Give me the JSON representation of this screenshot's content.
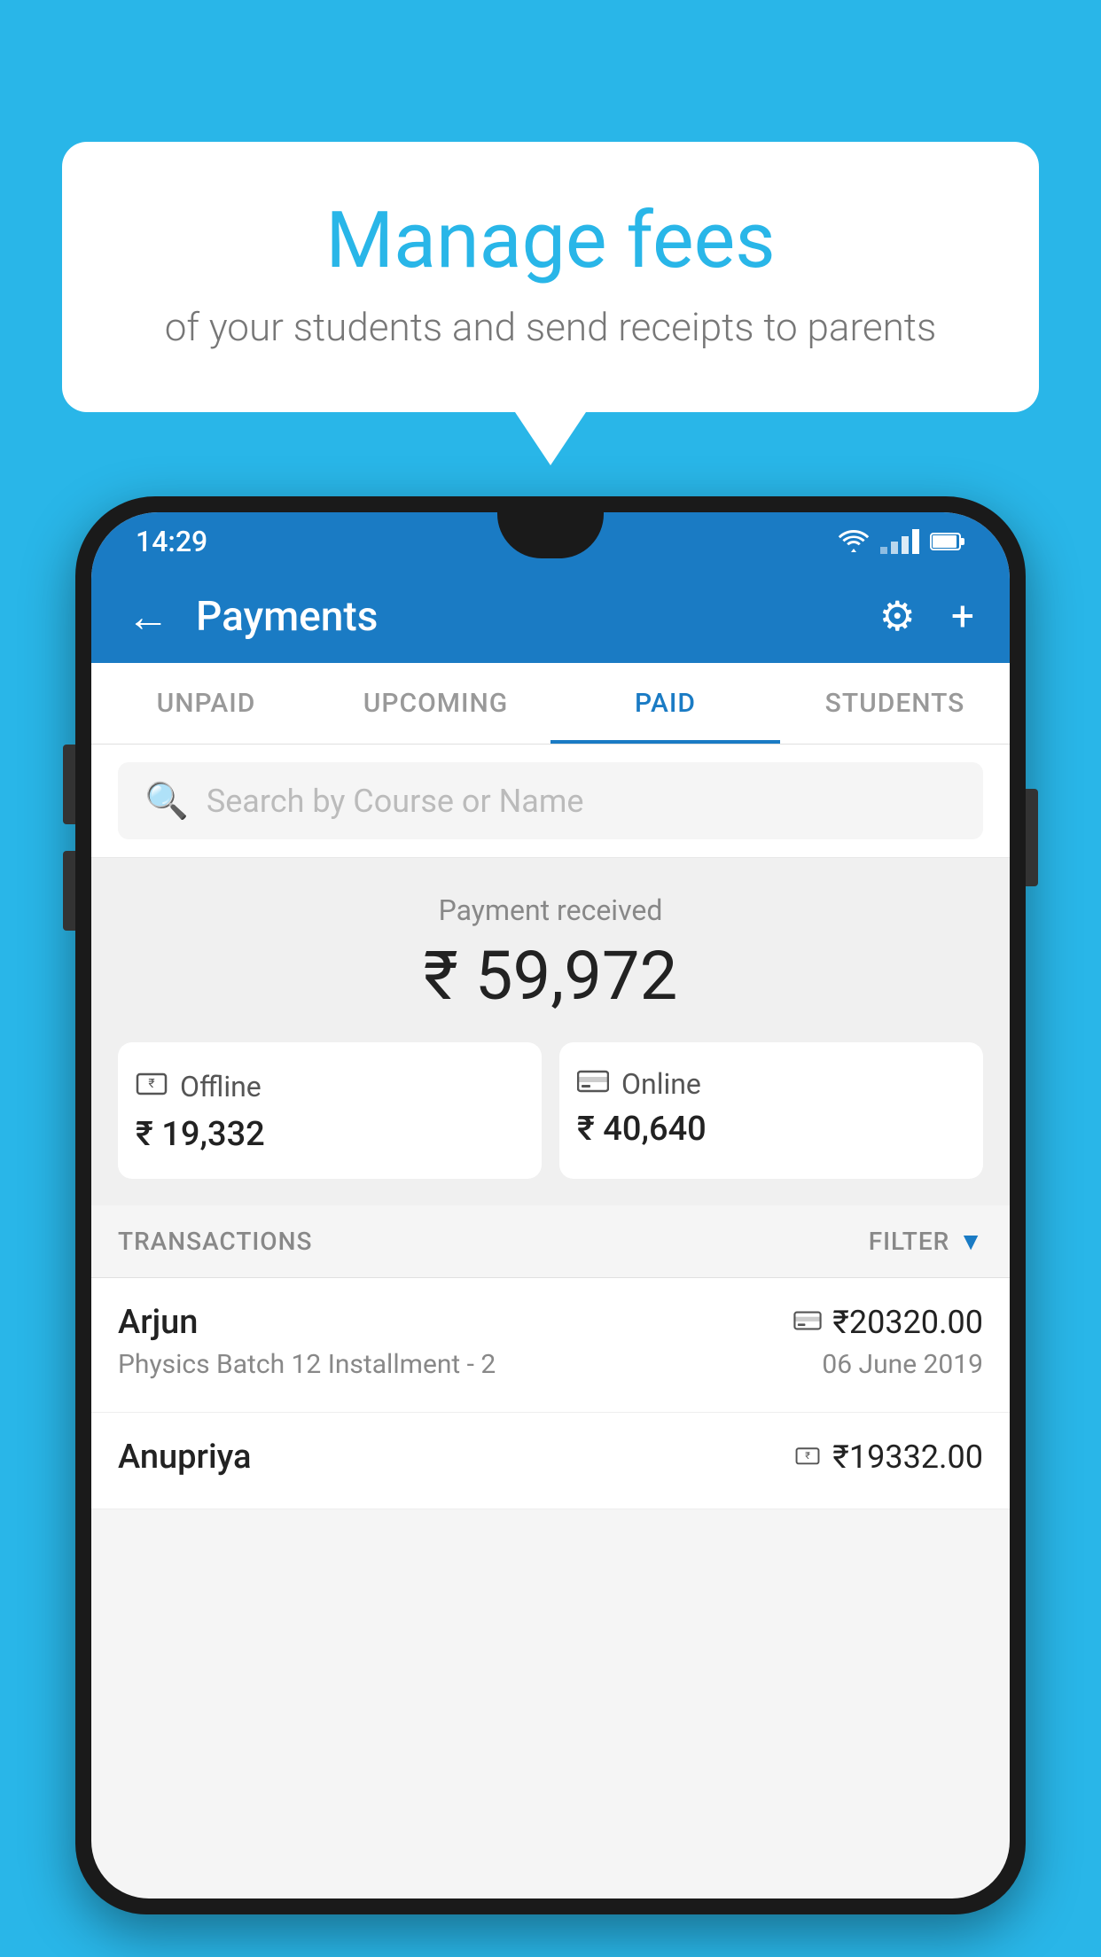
{
  "background_color": "#29b6e8",
  "speech_bubble": {
    "title": "Manage fees",
    "subtitle": "of your students and send receipts to parents"
  },
  "status_bar": {
    "time": "14:29"
  },
  "header": {
    "title": "Payments",
    "back_label": "←",
    "settings_label": "⚙",
    "add_label": "+"
  },
  "tabs": [
    {
      "label": "UNPAID",
      "active": false
    },
    {
      "label": "UPCOMING",
      "active": false
    },
    {
      "label": "PAID",
      "active": true
    },
    {
      "label": "STUDENTS",
      "active": false
    }
  ],
  "search": {
    "placeholder": "Search by Course or Name"
  },
  "payment_section": {
    "received_label": "Payment received",
    "total_amount": "₹ 59,972",
    "offline": {
      "label": "Offline",
      "amount": "₹ 19,332"
    },
    "online": {
      "label": "Online",
      "amount": "₹ 40,640"
    }
  },
  "transactions": {
    "label": "TRANSACTIONS",
    "filter_label": "FILTER",
    "items": [
      {
        "name": "Arjun",
        "course": "Physics Batch 12 Installment - 2",
        "amount": "₹20320.00",
        "date": "06 June 2019",
        "payment_type": "card"
      },
      {
        "name": "Anupriya",
        "course": "",
        "amount": "₹19332.00",
        "date": "",
        "payment_type": "cash"
      }
    ]
  }
}
